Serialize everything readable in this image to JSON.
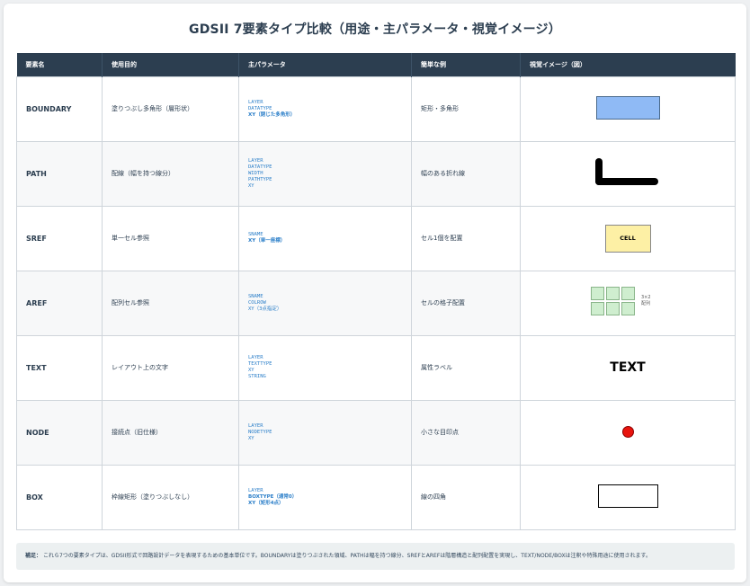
{
  "title": "GDSII 7要素タイプ比較（用途・主パラメータ・視覚イメージ）",
  "headers": [
    "要素名",
    "使用目的",
    "主パラメータ",
    "簡単な例",
    "視覚イメージ（図）"
  ],
  "rows": [
    {
      "name": "BOUNDARY",
      "purpose": "塗りつぶし多角形（層形状）",
      "params": [
        "LAYER",
        "DATATYPE",
        "XY（閉じた多角形）"
      ],
      "example": "矩形・多角形",
      "visual": "boundary-shape"
    },
    {
      "name": "PATH",
      "purpose": "配線（幅を持つ線分）",
      "params": [
        "LAYER",
        "DATATYPE",
        "WIDTH",
        "PATHTYPE",
        "XY"
      ],
      "example": "幅のある折れ線",
      "visual": "path-shape"
    },
    {
      "name": "SREF",
      "purpose": "単一セル参照",
      "params": [
        "SNAME",
        "XY（単一座標）"
      ],
      "example": "セル1個を配置",
      "visual": "sref-shape",
      "visual_label": "CELL"
    },
    {
      "name": "AREF",
      "purpose": "配列セル参照",
      "params": [
        "SNAME",
        "COLROW",
        "XY（3点指定）"
      ],
      "example": "セルの格子配置",
      "visual": "aref-grid",
      "visual_caption": [
        "3×2",
        "配列"
      ]
    },
    {
      "name": "TEXT",
      "purpose": "レイアウト上の文字",
      "params": [
        "LAYER",
        "TEXTTYPE",
        "XY",
        "STRING"
      ],
      "example": "属性ラベル",
      "visual": "text-sample",
      "visual_label": "TEXT"
    },
    {
      "name": "NODE",
      "purpose": "接続点（旧仕様）",
      "params": [
        "LAYER",
        "NODETYPE",
        "XY"
      ],
      "example": "小さな目印点",
      "visual": "node-dot"
    },
    {
      "name": "BOX",
      "purpose": "枠線矩形（塗りつぶしなし）",
      "params": [
        "LAYER",
        "BOXTYPE（通常0）",
        "XY（矩形4点）"
      ],
      "example": "線の四角",
      "visual": "box-outline"
    }
  ],
  "note": {
    "label": "補足：",
    "text": "これら7つの要素タイプは、GDSII形式で回路設計データを表現するための基本単位です。BOUNDARYは塗りつぶされた領域、PATHは幅を持つ線分、SREFとAREFは階層構造と配列配置を実現し、TEXT/NODE/BOXは注釈や特殊用途に使用されます。"
  },
  "colors": {
    "header_bg": "#2c3e50",
    "param_text": "#2c7fc9",
    "boundary_fill": "#8fbaf5",
    "sref_fill": "#fdf0a5",
    "aref_cell": "#cfeecf",
    "node_dot": "#e8140e"
  }
}
